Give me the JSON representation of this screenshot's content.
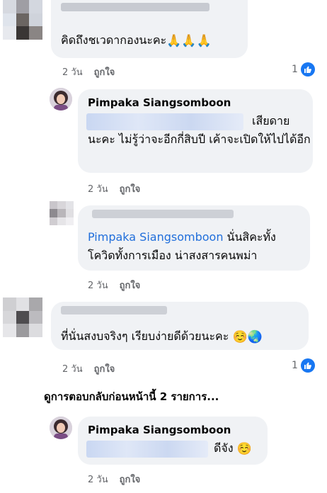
{
  "comments": [
    {
      "author": "",
      "text": "คิดถึงชเวดากองนะคะ",
      "emoji": "🙏🙏🙏",
      "time": "2 วัน",
      "like_label": "ถูกใจ",
      "likes": "1"
    },
    {
      "author": "Pimpaka Siangsomboon",
      "text_line1_suffix": "เสียดาย",
      "text_rest": "นะคะ ไม่รู้ว่าจะอีกกี่สิบปี เค้าจะเปิดให้ไปได้อีก",
      "time": "2 วัน",
      "like_label": "ถูกใจ"
    },
    {
      "author": "",
      "mention": "Pimpaka Siangsomboon",
      "text_after_mention": "นั่นสิคะทั้ง",
      "text_line2": "โควิดทั้งการเมือง น่าสงสารคนพม่า",
      "time": "2 วัน",
      "like_label": "ถูกใจ"
    },
    {
      "author": "",
      "text": "ที่นั่นสงบจริงๆ เรียบง่ายดีด้วยนะคะ",
      "emoji": "☺️🌏",
      "time": "2 วัน",
      "like_label": "ถูกใจ",
      "likes": "1"
    },
    {
      "author": "Pimpaka Siangsomboon",
      "text_suffix": "ดีจัง",
      "emoji": "☺️",
      "time": "2 วัน",
      "like_label": "ถูกใจ"
    }
  ],
  "view_previous": "ดูการตอบกลับก่อนหน้านี้ 2 รายการ...",
  "colors": {
    "bubble": "#f0f2f5",
    "link": "#216fdb",
    "like_blue": "#1877f2",
    "meta": "#65676b"
  },
  "icons": [
    "like-thumb-icon",
    "avatar-photo",
    "avatar-blurred"
  ]
}
